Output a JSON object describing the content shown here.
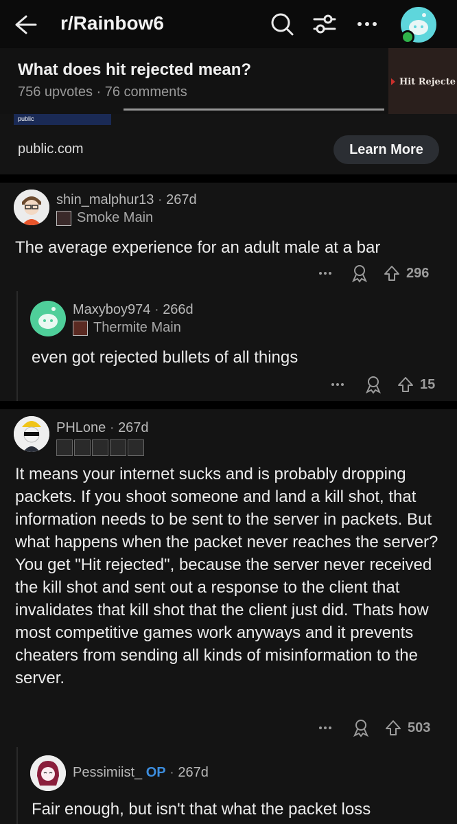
{
  "header": {
    "subreddit": "r/Rainbow6",
    "icons": [
      "back-arrow-icon",
      "search-icon",
      "filter-icon",
      "more-icon",
      "user-avatar"
    ]
  },
  "post": {
    "title": "What does hit rejected mean?",
    "meta": "756 upvotes · 76 comments",
    "thumbnail_text": "Hit Rejecte"
  },
  "ad": {
    "strip_label": "public",
    "url": "public.com",
    "cta": "Learn More"
  },
  "comments": [
    {
      "user": "shin_malphur13",
      "age": "267d",
      "flair": "Smoke Main",
      "text": "The average experience for an adult male at a bar",
      "votes": "296"
    },
    {
      "user": "Maxyboy974",
      "age": "266d",
      "flair": "Thermite Main",
      "text": "even got rejected bullets of all things",
      "votes": "15"
    },
    {
      "user": "PHLone",
      "age": "267d",
      "text": "It means your internet sucks and is probably dropping packets. If you shoot someone and land a kill shot, that information needs to be sent to the server in packets. But what happens when the packet never reaches the server? You get \"Hit rejected\", because the server never received the kill shot and sent out a response to the client that invalidates that kill shot that the client just did. Thats how most competitive games work anyways and it prevents cheaters from sending all kinds of misinformation to the server.",
      "votes": "503"
    },
    {
      "user": "Pessimiist_",
      "op_tag": "OP",
      "age": "267d",
      "text": "Fair enough, but isn't that what the packet loss"
    }
  ],
  "colors": {
    "background": "#0b0b0b",
    "card": "#141414",
    "op_blue": "#3c8dde",
    "avatar_cyan": "#5ed6dc"
  }
}
